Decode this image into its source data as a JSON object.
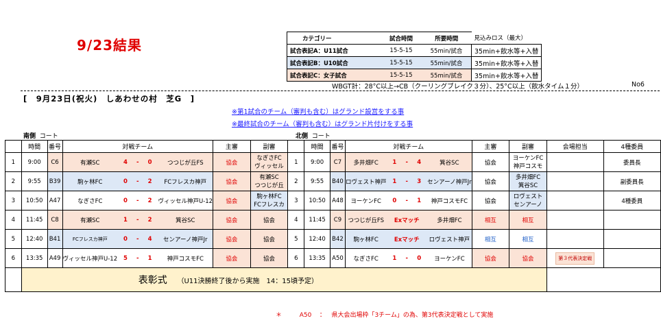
{
  "title": "9/23結果",
  "category": {
    "headers": [
      "カテゴリー",
      "試合時間",
      "所要時間",
      "見込みロス（最大）"
    ],
    "rows": [
      {
        "name": "試合表記A：U11試合",
        "time": "15-5-15",
        "duration": "55min/試合",
        "loss": "35min+飲水等+入替"
      },
      {
        "name": "試合表記B：U10試合",
        "time": "15-5-15",
        "duration": "55min/試合",
        "loss": "35min+飲水等+入替"
      },
      {
        "name": "試合表記C：女子試合",
        "time": "15-5-15",
        "duration": "55min/試合",
        "loss": "35min+飲水等+入替"
      }
    ]
  },
  "wbgt": "WBGT計：28°C以上→CB（クーリングブレイク３分）、25°C以上（飲水タイム１分）",
  "page_no": "No6",
  "venue": "[　9月23日(祝火)　しあわせの村　芝G　]",
  "notes": [
    "※第1試合のチーム（審判も含む）はグランド設営をする事",
    "※最終試合のチーム（審判も含む）はグランド片付けをする事"
  ],
  "south": {
    "side": "南側",
    "court": "コート"
  },
  "north": {
    "side": "北側",
    "court": "コート"
  },
  "headers": {
    "time": "時間",
    "num": "番号",
    "match": "対戦チーム",
    "ref": "主審",
    "aref": "副審",
    "venue_staff": "会場担当",
    "committee": "4種委員"
  },
  "rows": [
    {
      "idx": "1",
      "s": {
        "time": "9:00",
        "num": "C6",
        "home": "有瀬SC",
        "hs": "4",
        "sep": "-",
        "as": "0",
        "away": "つつじが丘FS",
        "ref": "協会",
        "aref1": "なぎさFC",
        "aref2": "ヴィッセル"
      },
      "n": {
        "idx": "1",
        "time": "9:00",
        "num": "C7",
        "home": "多井畑FC",
        "hs": "1",
        "sep": "-",
        "as": "4",
        "away": "箕谷SC",
        "ref": "協会",
        "aref1": "ヨーケンFC",
        "aref2": "神戸コスモ"
      },
      "venue_staff": "",
      "committee": "委員長"
    },
    {
      "idx": "2",
      "s": {
        "time": "9:55",
        "num": "B39",
        "home": "駒ヶ林FC",
        "hs": "0",
        "sep": "-",
        "as": "2",
        "away": "FCフレスカ神戸",
        "ref": "協会",
        "aref1": "有瀬SC",
        "aref2": "つつじが丘"
      },
      "n": {
        "idx": "2",
        "time": "9:55",
        "num": "B40",
        "home": "ロヴェスト神戸",
        "hs": "1",
        "sep": "-",
        "as": "3",
        "away": "センアーノ神戸Jr",
        "ref": "協会",
        "aref1": "多井畑FC",
        "aref2": "箕谷SC"
      },
      "venue_staff": "",
      "committee": "副委員長"
    },
    {
      "idx": "3",
      "s": {
        "time": "10:50",
        "num": "A47",
        "home": "なぎさFC",
        "hs": "0",
        "sep": "-",
        "as": "2",
        "away": "ヴィッセル神戸U-12",
        "ref": "協会",
        "aref1": "駒ヶ林FC",
        "aref2": "FCフレスカ"
      },
      "n": {
        "idx": "3",
        "time": "10:50",
        "num": "A48",
        "home": "ヨーケンFC",
        "hs": "0",
        "sep": "-",
        "as": "1",
        "away": "神戸コスモFC",
        "ref": "協会",
        "aref1": "ロヴェスト",
        "aref2": "センアーノ"
      },
      "venue_staff": "",
      "committee": "4種委員"
    },
    {
      "idx": "4",
      "s": {
        "time": "11:45",
        "num": "C8",
        "home": "有瀬SC",
        "hs": "1",
        "sep": "-",
        "as": "2",
        "away": "箕谷SC",
        "ref": "協会",
        "aref1": "協会",
        "aref2": ""
      },
      "n": {
        "idx": "4",
        "time": "11:45",
        "num": "C9",
        "home": "つつじが丘FS",
        "ex": "Exマッチ",
        "away": "多井畑FC",
        "ref": "相互",
        "aref1": "相互",
        "aref2": ""
      },
      "venue_staff": "",
      "committee": ""
    },
    {
      "idx": "5",
      "s": {
        "time": "12:40",
        "num": "B41",
        "home": "FCフレスカ神戸",
        "hs": "0",
        "sep": "-",
        "as": "4",
        "away": "センアーノ神戸Jr",
        "ref": "協会",
        "aref1": "協会",
        "aref2": ""
      },
      "n": {
        "idx": "5",
        "time": "12:40",
        "num": "B42",
        "home": "駒ヶ林FC",
        "ex": "Exマッチ",
        "away": "ロヴェスト神戸",
        "ref": "相互",
        "aref1": "相互",
        "aref2": ""
      },
      "venue_staff": "",
      "committee": ""
    },
    {
      "idx": "6",
      "s": {
        "time": "13:35",
        "num": "A49",
        "home": "ヴィッセル神戸U-12",
        "hs": "5",
        "sep": "-",
        "as": "1",
        "away": "神戸コスモFC",
        "ref": "協会",
        "aref1": "協会",
        "aref2": ""
      },
      "n": {
        "idx": "6",
        "time": "13:35",
        "num": "A50",
        "home": "なぎさFC",
        "hs": "1",
        "sep": "-",
        "as": "0",
        "away": "ヨーケンFC",
        "ref": "協会",
        "aref1": "協会",
        "aref2": ""
      },
      "venue_staff": "第３代表決定戦",
      "committee": ""
    }
  ],
  "award": {
    "label": "表彰式",
    "note": "（U11決勝終了後から実施　14：15頃予定）"
  },
  "footnote": {
    "mark": "＊",
    "code": "A50",
    "colon": "：",
    "text": "県大会出場枠「3チーム」の為、第3代表決定戦として実施"
  }
}
